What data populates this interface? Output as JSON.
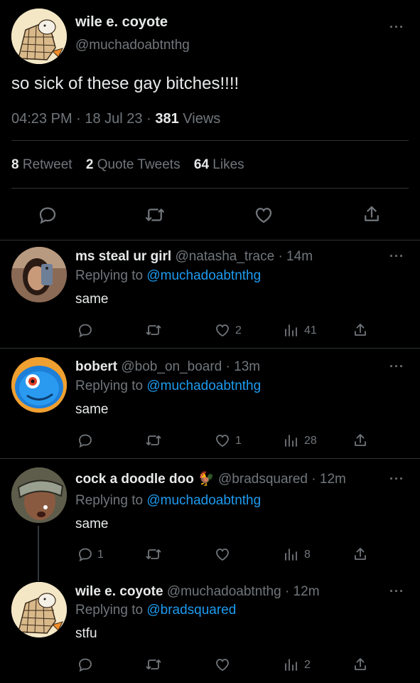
{
  "tweet": {
    "display_name": "wile e. coyote",
    "handle": "@muchadoabtnthg",
    "text": "so sick of these gay bitches!!!!",
    "time": "04:23 PM · 18 Jul 23",
    "sep": " · ",
    "views_count": "381",
    "views_label": " Views",
    "retweets_count": "8",
    "retweets_label": "Retweet",
    "quotes_count": "2",
    "quotes_label": "Quote Tweets",
    "likes_count": "64",
    "likes_label": "Likes",
    "more": "···"
  },
  "replies": [
    {
      "display_name": "ms steal ur girl",
      "handle": "@natasha_trace",
      "time": "· 14m",
      "replying_prefix": "Replying to ",
      "replying_to": "@muchadoabtnthg",
      "text": "same",
      "reply_count": "",
      "like_count": "2",
      "view_count": "41",
      "more": "···"
    },
    {
      "display_name": "bobert",
      "handle": "@bob_on_board",
      "time": "· 13m",
      "replying_prefix": "Replying to ",
      "replying_to": "@muchadoabtnthg",
      "text": "same",
      "reply_count": "",
      "like_count": "1",
      "view_count": "28",
      "more": "···"
    },
    {
      "display_name": "cock a doodle doo 🐓",
      "handle": "@bradsquared",
      "time": "· 12m",
      "replying_prefix": "Replying to ",
      "replying_to": "@muchadoabtnthg",
      "text": "same",
      "reply_count": "1",
      "like_count": "",
      "view_count": "8",
      "more": "···"
    },
    {
      "display_name": "wile e. coyote",
      "handle": "@muchadoabtnthg",
      "time": "· 12m",
      "replying_prefix": "Replying to ",
      "replying_to": "@bradsquared",
      "text": "stfu",
      "reply_count": "",
      "like_count": "",
      "view_count": "2",
      "more": "···"
    }
  ],
  "colors": {
    "background": "#000000",
    "text": "#e7e9ea",
    "muted": "#71767b",
    "link": "#1d9bf0",
    "divider": "#2f3336"
  },
  "icons": [
    "reply-icon",
    "retweet-icon",
    "like-icon",
    "views-icon",
    "share-icon"
  ]
}
